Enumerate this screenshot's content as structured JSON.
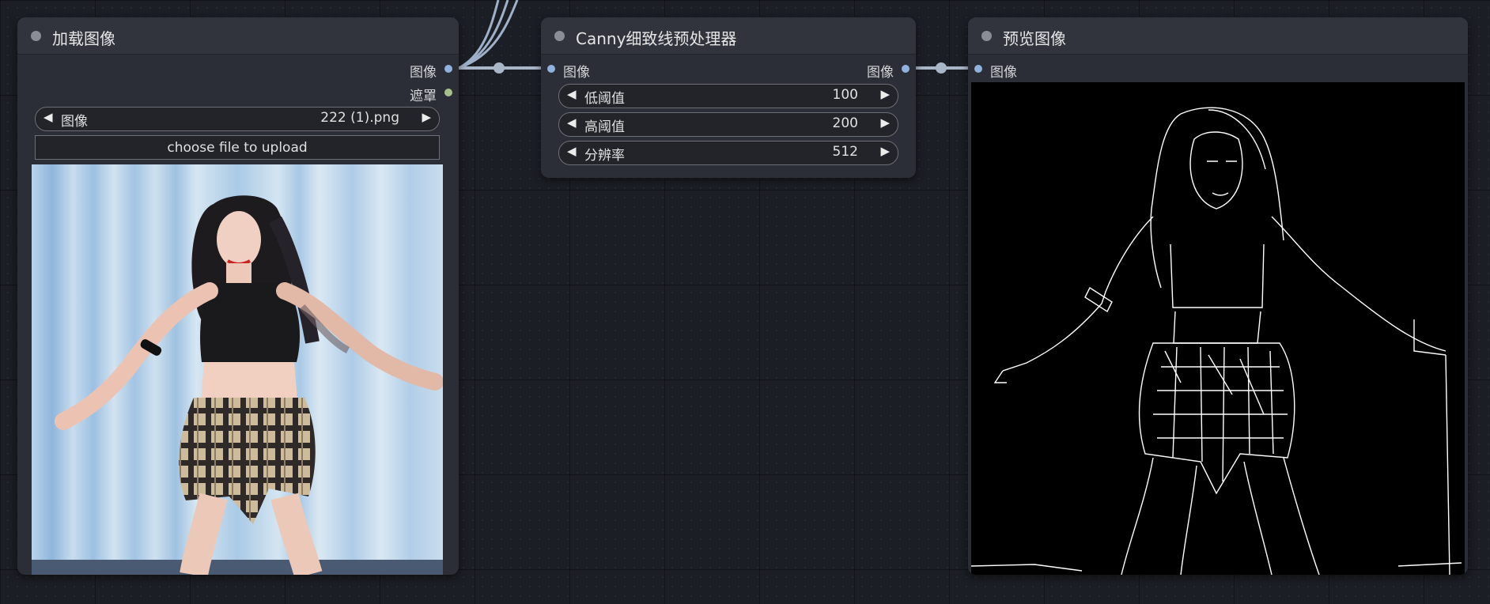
{
  "colors": {
    "canvas_bg": "#1b1e25",
    "node_bg": "#2b2e36",
    "link": "#9fb0c9",
    "image_slot": "#8fb3de",
    "mask_slot": "#a8c18a"
  },
  "load_node": {
    "title": "加载图像",
    "out_image_label": "图像",
    "out_mask_label": "遮罩",
    "image_widget": {
      "label": "图像",
      "value": "222 (1).png"
    },
    "upload_label": "choose file to upload",
    "preview_alt": "photo of a dancer in a black crop top and plaid skirt"
  },
  "canny_node": {
    "title": "Canny细致线预处理器",
    "in_image_label": "图像",
    "out_image_label": "图像",
    "widgets": [
      {
        "label": "低阈值",
        "value": "100"
      },
      {
        "label": "高阈值",
        "value": "200"
      },
      {
        "label": "分辨率",
        "value": "512"
      }
    ]
  },
  "preview_node": {
    "title": "预览图像",
    "in_image_label": "图像"
  }
}
